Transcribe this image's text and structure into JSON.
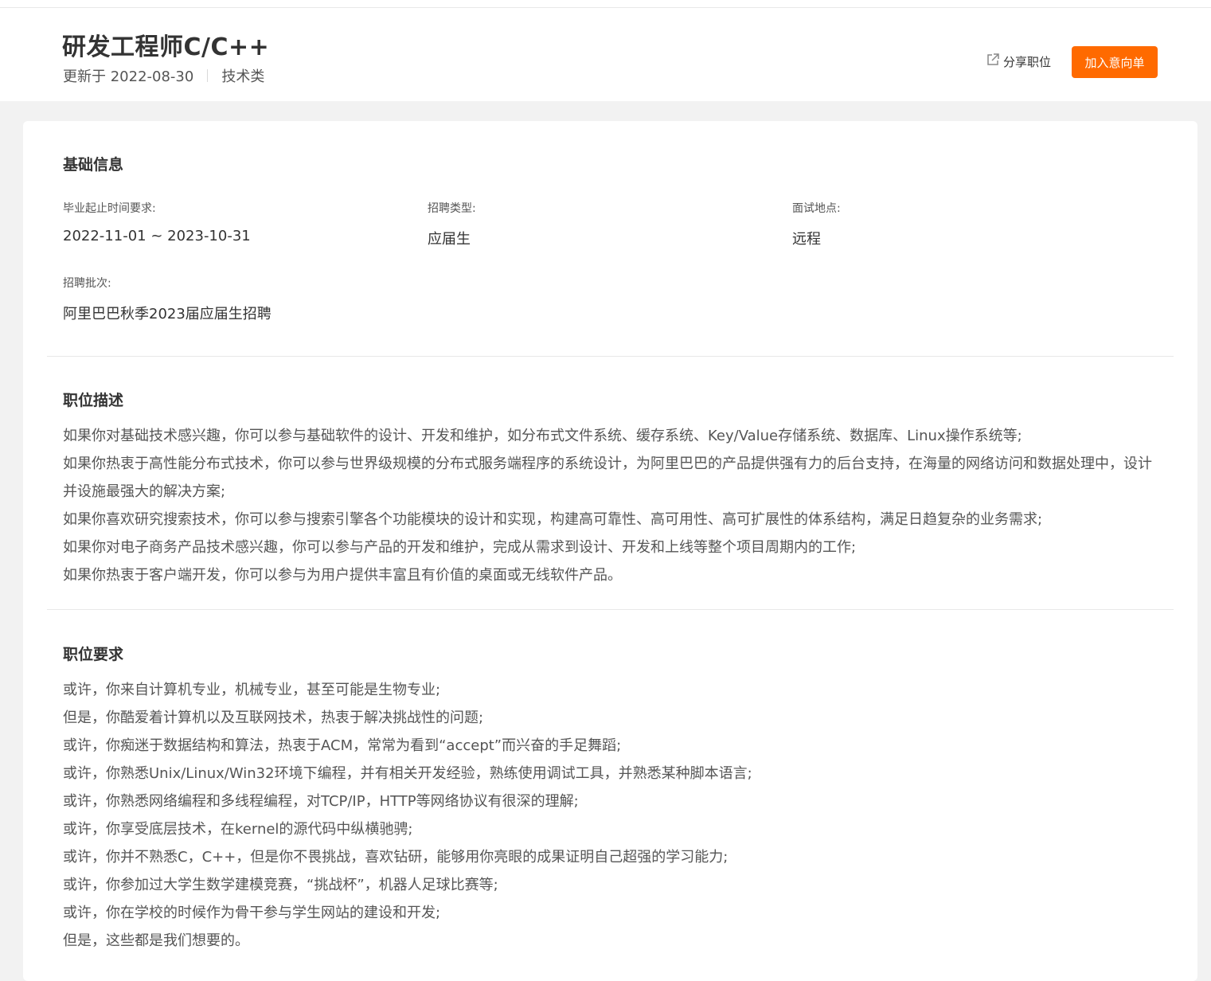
{
  "header": {
    "title": "研发工程师C/C++",
    "updated": "更新于 2022-08-30",
    "category": "技术类",
    "share_label": "分享职位",
    "add_label": "加入意向单"
  },
  "basic_info": {
    "section_title": "基础信息",
    "graduation_label": "毕业起止时间要求:",
    "graduation_value": "2022-11-01 ~ 2023-10-31",
    "type_label": "招聘类型:",
    "type_value": "应届生",
    "location_label": "面试地点:",
    "location_value": "远程",
    "batch_label": "招聘批次:",
    "batch_value": "阿里巴巴秋季2023届应届生招聘"
  },
  "description": {
    "section_title": "职位描述",
    "items": [
      "如果你对基础技术感兴趣，你可以参与基础软件的设计、开发和维护，如分布式文件系统、缓存系统、Key/Value存储系统、数据库、Linux操作系统等;",
      "如果你热衷于高性能分布式技术，你可以参与世界级规模的分布式服务端程序的系统设计，为阿里巴巴的产品提供强有力的后台支持，在海量的网络访问和数据处理中，设计并设施最强大的解决方案;",
      "如果你喜欢研究搜索技术，你可以参与搜索引擎各个功能模块的设计和实现，构建高可靠性、高可用性、高可扩展性的体系结构，满足日趋复杂的业务需求;",
      "如果你对电子商务产品技术感兴趣，你可以参与产品的开发和维护，完成从需求到设计、开发和上线等整个项目周期内的工作;",
      "如果你热衷于客户端开发，你可以参与为用户提供丰富且有价值的桌面或无线软件产品。"
    ]
  },
  "requirements": {
    "section_title": "职位要求",
    "items": [
      "或许，你来自计算机专业，机械专业，甚至可能是生物专业;",
      "但是，你酷爱着计算机以及互联网技术，热衷于解决挑战性的问题;",
      "或许，你痴迷于数据结构和算法，热衷于ACM，常常为看到“accept”而兴奋的手足舞蹈;",
      "或许，你熟悉Unix/Linux/Win32环境下编程，并有相关开发经验，熟练使用调试工具，并熟悉某种脚本语言;",
      "或许，你熟悉网络编程和多线程编程，对TCP/IP，HTTP等网络协议有很深的理解;",
      "或许，你享受底层技术，在kernel的源代码中纵横驰骋;",
      "或许，你并不熟悉C，C++，但是你不畏挑战，喜欢钻研，能够用你亮眼的成果证明自己超强的学习能力;",
      "或许，你参加过大学生数学建模竞赛，“挑战杯”，机器人足球比赛等;",
      "或许，你在学校的时候作为骨干参与学生网站的建设和开发;",
      "但是，这些都是我们想要的。"
    ]
  },
  "colors": {
    "accent": "#ff6a00",
    "background": "#f2f2f2",
    "text": "#333333"
  }
}
